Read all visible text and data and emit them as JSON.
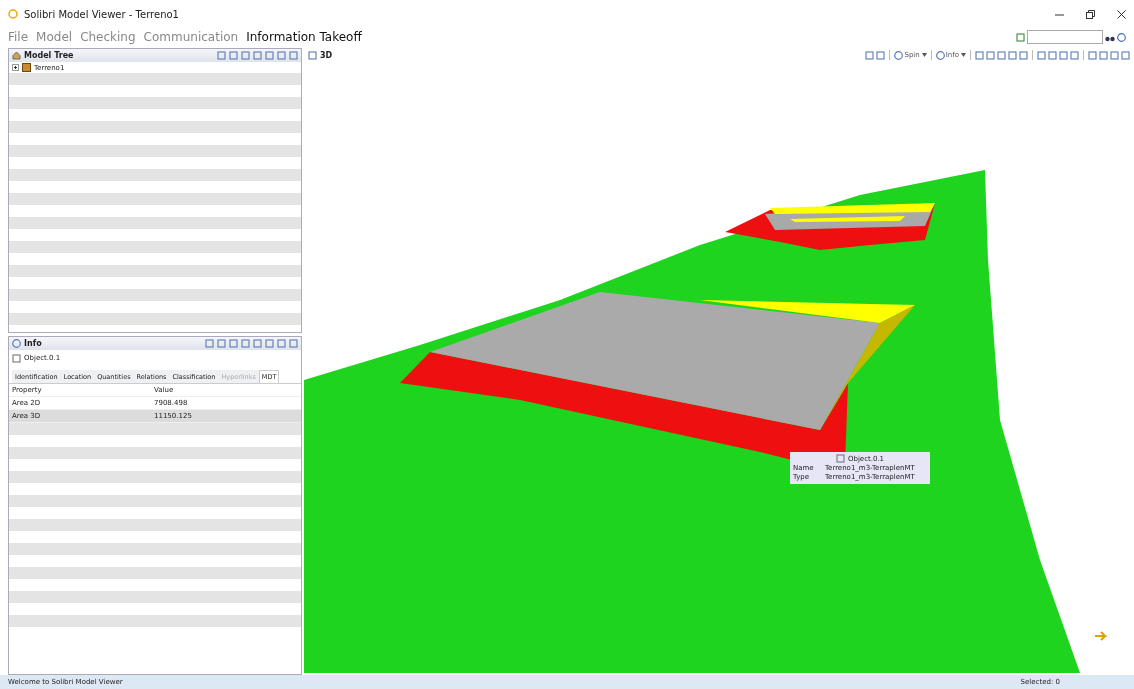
{
  "window": {
    "title": "Solibri Model Viewer - Terreno1"
  },
  "menu": [
    {
      "label": "File",
      "selected": false
    },
    {
      "label": "Model",
      "selected": false
    },
    {
      "label": "Checking",
      "selected": false
    },
    {
      "label": "Communication",
      "selected": false
    },
    {
      "label": "Information Takeoff",
      "selected": true
    }
  ],
  "model_tree": {
    "title": "Model Tree",
    "items": [
      {
        "label": "Terreno1"
      }
    ]
  },
  "info": {
    "title": "Info",
    "object": "Object.0.1",
    "tabs": [
      {
        "label": "Identification",
        "selected": false,
        "disabled": false
      },
      {
        "label": "Location",
        "selected": false,
        "disabled": false
      },
      {
        "label": "Quantities",
        "selected": false,
        "disabled": false
      },
      {
        "label": "Relations",
        "selected": false,
        "disabled": false
      },
      {
        "label": "Classification",
        "selected": false,
        "disabled": false
      },
      {
        "label": "Hyperlinks",
        "selected": false,
        "disabled": true
      },
      {
        "label": "MDT",
        "selected": true,
        "disabled": false
      }
    ],
    "columns": [
      "Property",
      "Value"
    ],
    "rows": [
      {
        "cells": [
          "Area 2D",
          "7908.498"
        ],
        "selected": false
      },
      {
        "cells": [
          "Area 3D",
          "11150.125"
        ],
        "selected": true
      }
    ]
  },
  "view": {
    "title": "3D",
    "toolbar": [
      {
        "kind": "icon"
      },
      {
        "kind": "icon"
      },
      {
        "kind": "sep"
      },
      {
        "kind": "text",
        "label": "Spin"
      },
      {
        "kind": "sep"
      },
      {
        "kind": "text",
        "label": "Info"
      },
      {
        "kind": "sep"
      },
      {
        "kind": "icon"
      },
      {
        "kind": "icon"
      },
      {
        "kind": "icon"
      },
      {
        "kind": "icon"
      },
      {
        "kind": "icon"
      },
      {
        "kind": "sep"
      },
      {
        "kind": "icon"
      },
      {
        "kind": "icon"
      },
      {
        "kind": "icon"
      },
      {
        "kind": "icon"
      },
      {
        "kind": "sep"
      },
      {
        "kind": "icon"
      },
      {
        "kind": "icon"
      },
      {
        "kind": "icon"
      },
      {
        "kind": "icon"
      }
    ],
    "tooltip": {
      "title": "Object.0.1",
      "rows": [
        {
          "key": "Name",
          "value": "Terreno1_m3-TerraplenMT"
        },
        {
          "key": "Type",
          "value": "Terreno1_m3-TerraplenMT"
        }
      ]
    }
  },
  "status_bar": {
    "message": "Welcome to Solibri Model Viewer",
    "selected": "Selected: 0"
  }
}
